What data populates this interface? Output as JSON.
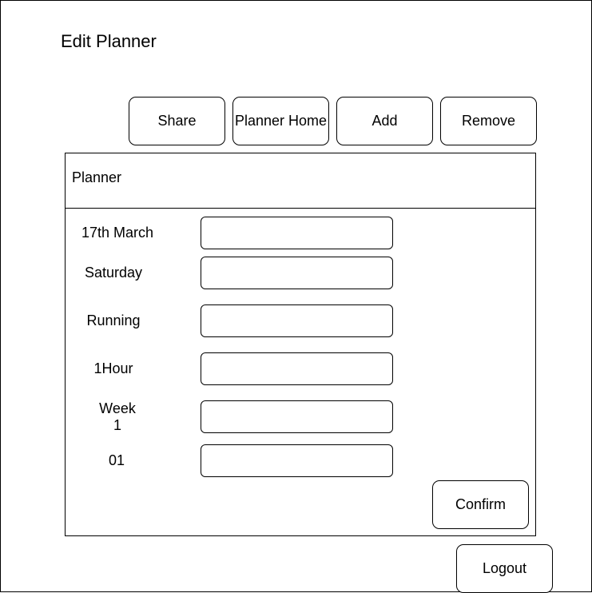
{
  "page": {
    "title": "Edit Planner"
  },
  "toolbar": {
    "share_label": "Share",
    "planner_home_label": "Planner Home",
    "add_label": "Add",
    "remove_label": "Remove"
  },
  "panel": {
    "title": "Planner",
    "fields": [
      {
        "label": "17th March",
        "value": ""
      },
      {
        "label": "Saturday",
        "value": ""
      },
      {
        "label": "Running",
        "value": ""
      },
      {
        "label": "1Hour",
        "value": ""
      },
      {
        "label_line1": "Week",
        "label_line2": "1",
        "value": ""
      },
      {
        "label": "01",
        "value": ""
      }
    ],
    "confirm_label": "Confirm"
  },
  "footer": {
    "logout_label": "Logout"
  }
}
